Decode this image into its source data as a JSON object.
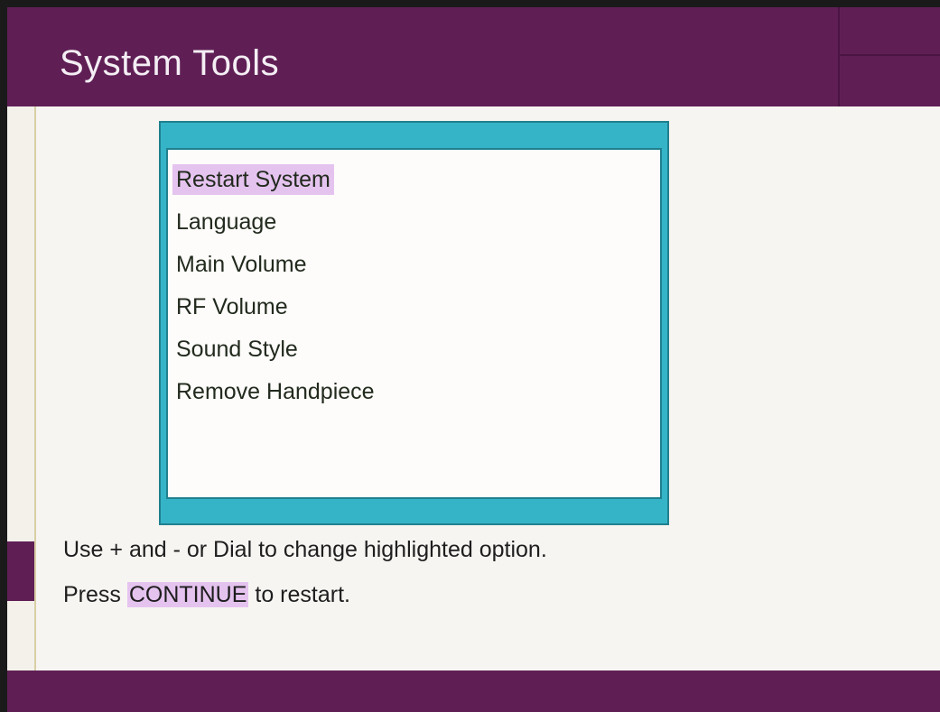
{
  "header": {
    "title": "System Tools"
  },
  "menu": {
    "selected_index": 0,
    "items": [
      {
        "label": "Restart System"
      },
      {
        "label": "Language"
      },
      {
        "label": "Main Volume"
      },
      {
        "label": "RF Volume"
      },
      {
        "label": "Sound Style"
      },
      {
        "label": "Remove Handpiece"
      }
    ]
  },
  "instructions": {
    "line1": "Use + and - or Dial to change highlighted option.",
    "line2_prefix": "Press ",
    "line2_keyword": "CONTINUE",
    "line2_suffix": " to restart."
  },
  "colors": {
    "header_bg": "#5f1f55",
    "listbox_frame": "#35b4c8",
    "highlight": "#e5c3ef",
    "screen_bg": "#f7f5f2"
  }
}
